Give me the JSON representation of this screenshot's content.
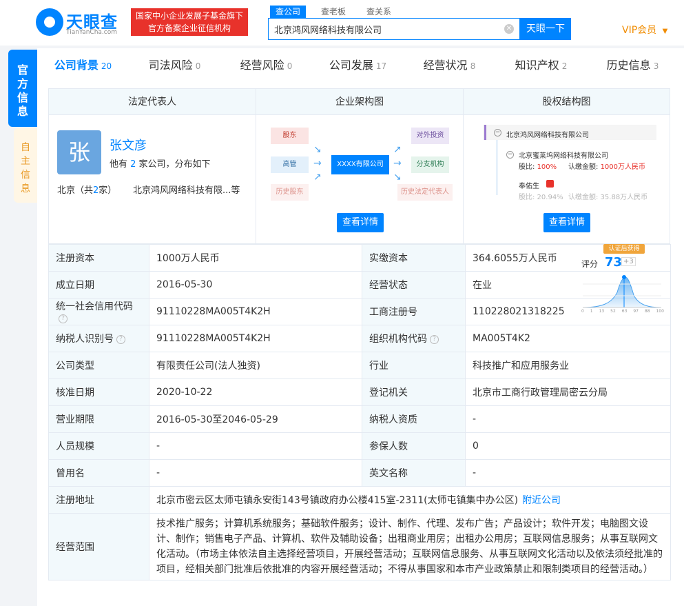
{
  "header": {
    "logo_text": "天眼查",
    "logo_sub": "TianYanCha.com",
    "badge_line1": "国家中小企业发展子基金旗下",
    "badge_line2": "官方备案企业征信机构",
    "search_tabs": [
      "查公司",
      "查老板",
      "查关系"
    ],
    "search_value": "北京鸿风网络科技有限公司",
    "search_button": "天眼一下",
    "vip": "VIP会员"
  },
  "side": {
    "tab1": "官方信息",
    "tab2": "自主信息"
  },
  "nav": [
    {
      "label": "公司背景",
      "count": "20"
    },
    {
      "label": "司法风险",
      "count": "0"
    },
    {
      "label": "经营风险",
      "count": "0"
    },
    {
      "label": "公司发展",
      "count": "17"
    },
    {
      "label": "经营状况",
      "count": "8"
    },
    {
      "label": "知识产权",
      "count": "2"
    },
    {
      "label": "历史信息",
      "count": "3"
    }
  ],
  "overview": {
    "col1_title": "法定代表人",
    "col2_title": "企业架构图",
    "col3_title": "股权结构图",
    "avatar_char": "张",
    "rep_name": "张文彦",
    "rep_desc_pre": "他有 ",
    "rep_desc_num": "2",
    "rep_desc_post": " 家公司，分布如下",
    "rep_loc_pre": "北京（共",
    "rep_loc_num": "2",
    "rep_loc_post": "家）",
    "rep_company": "北京鸿风网络科技有限...等",
    "org": {
      "shareholder": "股东",
      "executive": "高管",
      "history_shareholder": "历史股东",
      "center": "XXXX有限公司",
      "investment": "对外投资",
      "branch": "分支机构",
      "history_rep": "历史法定代表人"
    },
    "detail_btn": "查看详情",
    "equity": {
      "root": "北京鸿风网络科技有限公司",
      "holder1": "北京蜜莱坞网络科技有限公司",
      "holder1_ratio_label": "股比: ",
      "holder1_ratio": "100%",
      "holder1_amount_label": "认缴金额: ",
      "holder1_amount": "1000万人民币",
      "holder2": "奉佑生",
      "holder2_ratio": "股比: 20.94%",
      "holder2_amount": "认缴金额: 35.88万人民币"
    }
  },
  "score": {
    "tag": "认证后获得",
    "label": "评分",
    "value": "73",
    "delta": "+3",
    "axis": [
      "0",
      "1",
      "13",
      "52",
      "63",
      "97",
      "88",
      "100"
    ]
  },
  "table": {
    "rows": [
      {
        "k1": "注册资本",
        "v1": "1000万人民币",
        "k2": "实缴资本",
        "v2": "364.6055万人民币"
      },
      {
        "k1": "成立日期",
        "v1": "2016-05-30",
        "k2": "经营状态",
        "v2": "在业"
      },
      {
        "k1": "统一社会信用代码",
        "v1": "91110228MA005T4K2H",
        "k2": "工商注册号",
        "v2": "110228021318225"
      },
      {
        "k1": "纳税人识别号",
        "v1": "91110228MA005T4K2H",
        "k2": "组织机构代码",
        "v2": "MA005T4K2"
      },
      {
        "k1": "公司类型",
        "v1": "有限责任公司(法人独资)",
        "k2": "行业",
        "v2": "科技推广和应用服务业"
      },
      {
        "k1": "核准日期",
        "v1": "2020-10-22",
        "k2": "登记机关",
        "v2": "北京市工商行政管理局密云分局"
      },
      {
        "k1": "营业期限",
        "v1": "2016-05-30至2046-05-29",
        "k2": "纳税人资质",
        "v2": "-"
      },
      {
        "k1": "人员规模",
        "v1": "-",
        "k2": "参保人数",
        "v2": "0"
      },
      {
        "k1": "曾用名",
        "v1": "-",
        "k2": "英文名称",
        "v2": "-"
      }
    ],
    "address_key": "注册地址",
    "address_val": "北京市密云区太师屯镇永安街143号镇政府办公楼415室-2311(太师屯镇集中办公区)",
    "address_link": "附近公司",
    "scope_key": "经营范围",
    "scope_val": "技术推广服务；计算机系统服务；基础软件服务；设计、制作、代理、发布广告；产品设计；软件开发；电脑图文设计、制作；销售电子产品、计算机、软件及辅助设备；出租商业用房；出租办公用房；互联网信息服务；从事互联网文化活动。（市场主体依法自主选择经营项目，开展经营活动；互联网信息服务、从事互联网文化活动以及依法须经批准的项目，经相关部门批准后依批准的内容开展经营活动；不得从事国家和本市产业政策禁止和限制类项目的经营活动。）"
  }
}
